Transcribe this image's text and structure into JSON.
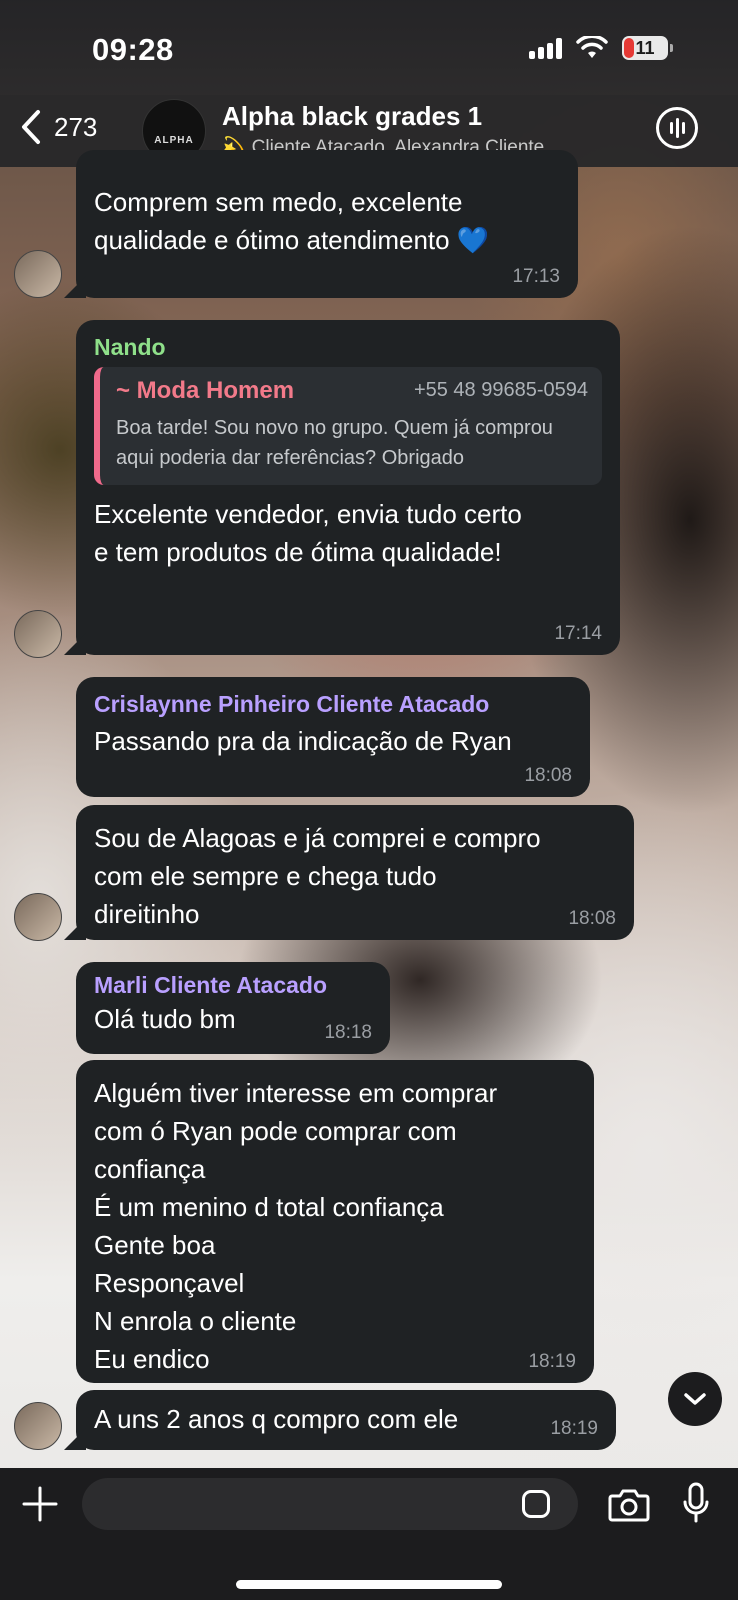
{
  "status_bar": {
    "time": "09:28",
    "battery": "11"
  },
  "header": {
    "back_count": "273",
    "title": "Alpha black grades 1",
    "subtitle_emoji": "💫",
    "subtitle": "Cliente Atacado, Alexandra Cliente...",
    "avatar_text": "ALPHA"
  },
  "messages": [
    {
      "sender": "",
      "text": "Comprem sem medo, excelente\nqualidade e ótimo atendimento 💙",
      "time": "17:13"
    },
    {
      "sender": "Nando",
      "quote": {
        "name": "~ Moda Homem",
        "phone": "+55 48 99685-0594",
        "text": "Boa tarde! Sou novo no grupo. Quem já\ncomprou aqui poderia dar referências?\nObrigado"
      },
      "text": "Excelente vendedor, envia tudo certo\ne tem produtos de ótima qualidade!",
      "time": "17:14"
    },
    {
      "sender": "Crislaynne Pinheiro Cliente Atacado",
      "text": "Passando pra da indicação de Ryan",
      "time": "18:08"
    },
    {
      "sender": "",
      "text": "Sou de Alagoas e já comprei e compro\ncom ele sempre e chega tudo\ndireitinho",
      "time": "18:08"
    },
    {
      "sender": "Marli Cliente Atacado",
      "text": "Olá tudo bm",
      "time": "18:18"
    },
    {
      "sender": "",
      "text": "Alguém tiver interesse em comprar\ncom ó Ryan pode comprar com\nconfiança\nÉ um menino d total confiança\nGente boa\nResponçavel\nN enrola o cliente\nEu endico",
      "time": "18:19"
    },
    {
      "sender": "",
      "text": "A uns 2 anos q compro com ele",
      "time": "18:19"
    }
  ],
  "colors": {
    "bubble": "#1f2224",
    "sender_nando": "#8fe08a",
    "sender_purple": "#b9a0ff",
    "quote_accent": "#f06a8b"
  }
}
